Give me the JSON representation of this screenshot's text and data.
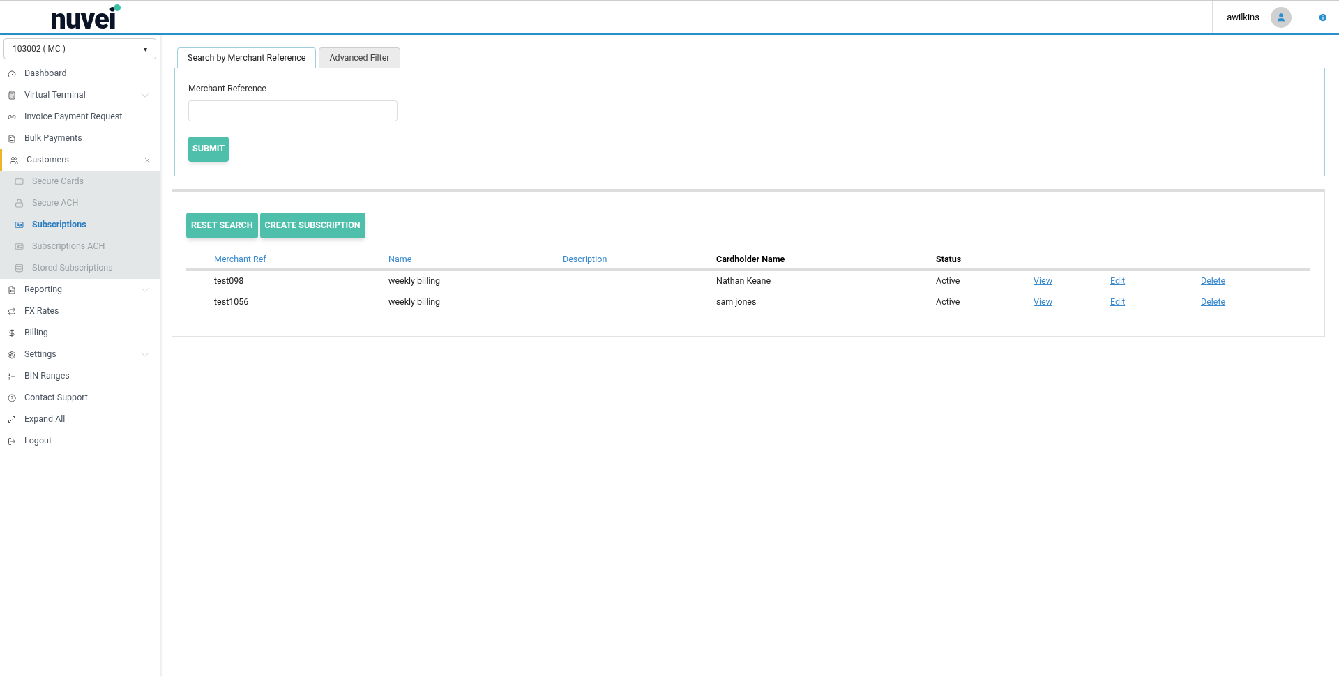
{
  "header": {
    "logo": "nuvei",
    "user": "awilkins"
  },
  "sidebar": {
    "account_select": "103002 ( MC )",
    "select_caret": "▾",
    "items": [
      {
        "label": "Dashboard",
        "selected": false
      },
      {
        "label": "Virtual Terminal",
        "selected": false,
        "expanded": false
      },
      {
        "label": "Invoice Payment Request",
        "selected": false
      },
      {
        "label": "Bulk Payments",
        "selected": false
      },
      {
        "label": "Customers",
        "selected": true,
        "expanded": true,
        "children": [
          {
            "label": "Secure Cards",
            "selected": false
          },
          {
            "label": "Secure ACH",
            "selected": false
          },
          {
            "label": "Subscriptions",
            "selected": true
          },
          {
            "label": "Subscriptions ACH",
            "selected": false
          },
          {
            "label": "Stored Subscriptions",
            "selected": false
          }
        ]
      },
      {
        "label": "Reporting",
        "selected": false,
        "expanded": false
      },
      {
        "label": "FX Rates",
        "selected": false
      },
      {
        "label": "Billing",
        "selected": false
      },
      {
        "label": "Settings",
        "selected": false,
        "expanded": false
      },
      {
        "label": "BIN Ranges",
        "selected": false
      },
      {
        "label": "Contact Support",
        "selected": false
      },
      {
        "label": "Expand All",
        "selected": false
      },
      {
        "label": "Logout",
        "selected": false
      }
    ]
  },
  "tabs": [
    {
      "label": "Search by Merchant Reference",
      "selected": true
    },
    {
      "label": "Advanced Filter",
      "selected": false
    }
  ],
  "search_form": {
    "label": "Merchant Reference",
    "submit": "SUBMIT"
  },
  "results": {
    "buttons": [
      "RESET SEARCH",
      "CREATE SUBSCRIPTION"
    ],
    "columns": [
      {
        "label": "Merchant Ref",
        "sortable": true
      },
      {
        "label": "Name",
        "sortable": true
      },
      {
        "label": "Description",
        "sortable": true
      },
      {
        "label": "Cardholder Name",
        "sortable": false
      },
      {
        "label": "Status",
        "sortable": false
      }
    ],
    "rows": [
      {
        "cells": [
          "test098",
          "weekly billing",
          "",
          "Nathan Keane",
          "Active"
        ],
        "actions": [
          "View",
          "Edit",
          "Delete"
        ]
      },
      {
        "cells": [
          "test1056",
          "weekly billing",
          "",
          "sam jones",
          "Active"
        ],
        "actions": [
          "View",
          "Edit",
          "Delete"
        ]
      }
    ]
  }
}
